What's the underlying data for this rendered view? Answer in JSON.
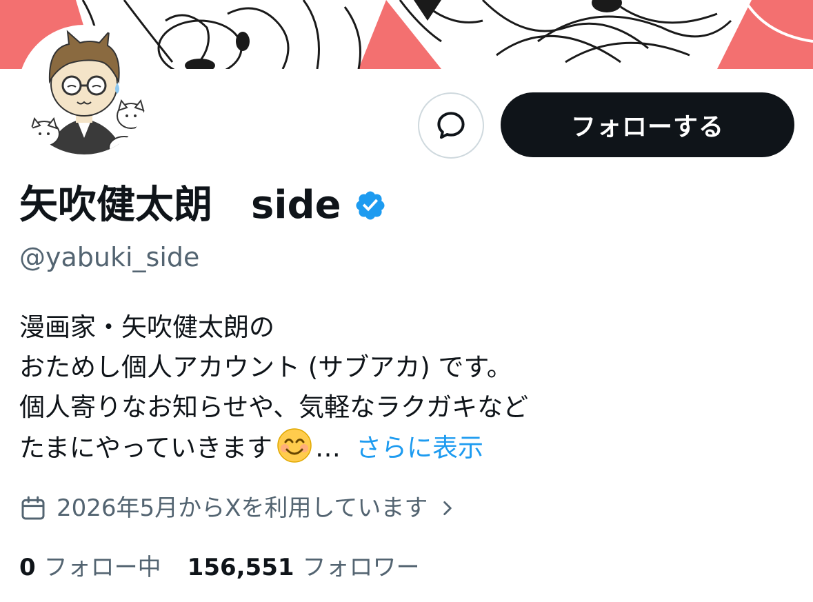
{
  "colors": {
    "banner": "#f37070",
    "primary_text": "#0f1419",
    "secondary_text": "#536471",
    "link": "#1d9bf0",
    "verified": "#1d9bf0",
    "follow_button_bg": "#0f1419"
  },
  "header": {
    "banner_icon": "manga-illustration-banner",
    "avatar_icon": "cartoon-man-with-cats-avatar"
  },
  "actions": {
    "message_icon": "chat-bubble-icon",
    "follow_label": "フォローする"
  },
  "profile": {
    "display_name": "矢吹健太朗　side",
    "verified_icon": "verified-badge-icon",
    "handle": "@yabuki_side",
    "bio_lines": [
      "漫画家・矢吹健太朗の",
      "おためし個人アカウント (サブアカ) です。",
      "個人寄りなお知らせや、気軽なラクガキなど",
      "たまにやっていきます"
    ],
    "bio_emoji": "smiling-face-icon",
    "bio_ellipsis": "…",
    "show_more": "さらに表示",
    "joined_icon": "calendar-icon",
    "joined_text": "2026年5月からXを利用しています",
    "joined_chevron": "chevron-right-icon"
  },
  "stats": {
    "following_count": "0",
    "following_label": "フォロー中",
    "followers_count": "156,551",
    "followers_label": "フォロワー"
  }
}
